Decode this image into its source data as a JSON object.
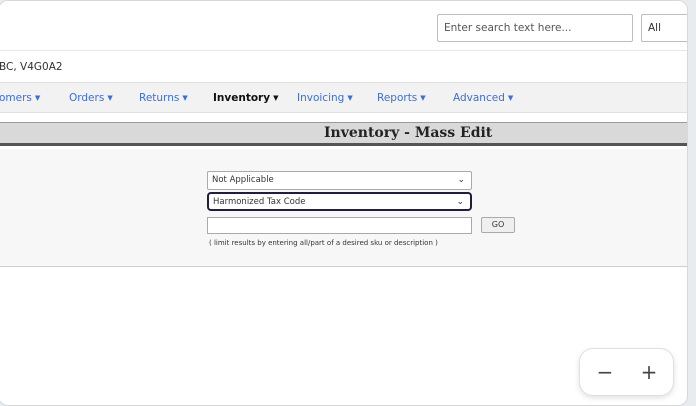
{
  "header": {
    "search_placeholder": "Enter search text here...",
    "scope_value": "All"
  },
  "address": {
    "text": "BC, V4G0A2"
  },
  "nav": {
    "items": [
      {
        "label": "omers"
      },
      {
        "label": "Orders"
      },
      {
        "label": "Returns"
      },
      {
        "label": "Inventory"
      },
      {
        "label": "Invoicing"
      },
      {
        "label": "Reports"
      },
      {
        "label": "Advanced"
      }
    ],
    "active": "Inventory",
    "link_color": "#3b6fd8"
  },
  "page": {
    "title": "Inventory - Mass Edit"
  },
  "form": {
    "select1_value": "Not Applicable",
    "select2_value": "Harmonized Tax Code",
    "go_label": "GO",
    "hint": "( limit results by entering all/part of a desired sku or description )"
  },
  "zoom": {
    "minus": "−",
    "plus": "+"
  }
}
